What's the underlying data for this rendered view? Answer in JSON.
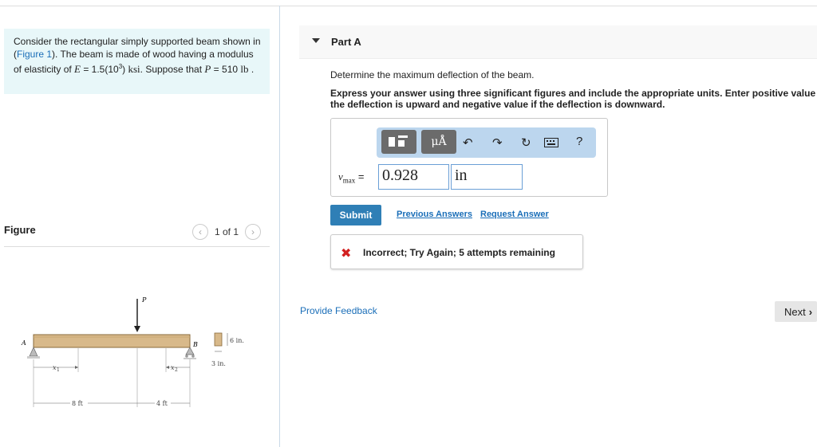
{
  "problem": {
    "text_1": "Consider the rectangular simply supported beam shown in (",
    "figure_link": "Figure 1",
    "text_2": "). The beam is made of wood having a modulus of elasticity of ",
    "E_symbol": "E",
    "text_3": " = 1.5(10",
    "exp": "3",
    "text_4": ") ",
    "E_unit": "ksi",
    "text_5": ". Suppose that ",
    "P_symbol": "P",
    "text_6": " = 510 ",
    "P_unit": "lb",
    "text_7": " ."
  },
  "figure": {
    "label": "Figure",
    "pager_text": "1 of 1",
    "prev_icon": "chevron-left-icon",
    "next_icon": "chevron-right-icon",
    "load_label": "P",
    "support_a": "A",
    "support_b": "B",
    "x1": "x",
    "x1_sub": "1",
    "x2": "x",
    "x2_sub": "2",
    "dim_8ft": "8 ft",
    "dim_4ft": "4 ft",
    "dim_6in": "6 in.",
    "dim_3in": "3 in.",
    "beam_color": "#d8b98a"
  },
  "part": {
    "title": "Part A",
    "question": "Determine the maximum deflection of the beam.",
    "instructions": "Express your answer using three significant figures and include the appropriate units. Enter positive value if the deflection is upward and negative value if the deflection is downward."
  },
  "toolbar": {
    "template_icon": "template-icon",
    "units_label": "μÅ",
    "undo_icon": "undo-icon",
    "redo_icon": "redo-icon",
    "reset_icon": "reset-icon",
    "keyboard_icon": "keyboard-icon",
    "help_label": "?"
  },
  "answer": {
    "var": "v",
    "var_sub": "max",
    "equals": " =",
    "value": "0.928",
    "unit": "in"
  },
  "actions": {
    "submit": "Submit",
    "previous_answers": "Previous Answers",
    "request_answer": "Request Answer"
  },
  "feedback": {
    "text": "Incorrect; Try Again; 5 attempts remaining"
  },
  "footer": {
    "provide_feedback": "Provide Feedback",
    "next": "Next"
  },
  "colors": {
    "accent": "#2f7fb6",
    "link": "#1a6eb8",
    "error": "#d22020",
    "problem_bg": "#e8f7f9"
  }
}
